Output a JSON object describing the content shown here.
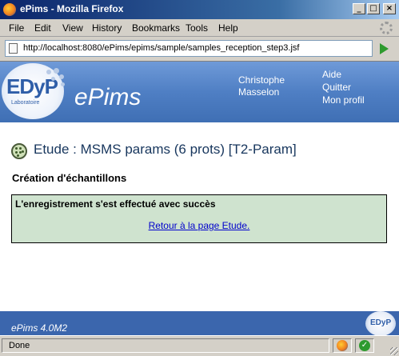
{
  "window": {
    "title": "ePims - Mozilla Firefox",
    "controls": {
      "minimize": "_",
      "maximize": "□",
      "close": "×"
    }
  },
  "menubar": {
    "items": [
      "File",
      "Edit",
      "View",
      "History",
      "Bookmarks",
      "Tools",
      "Help"
    ]
  },
  "navbar": {
    "url": "http://localhost:8080/ePims/epims/sample/samples_reception_step3.jsf"
  },
  "banner": {
    "logo_text": "EDyP",
    "logo_sub": "Laboratoire",
    "app_name": "ePims",
    "user_name": "Christophe Masselon",
    "links": [
      "Aide",
      "Quitter",
      "Mon profil"
    ]
  },
  "main": {
    "page_title": "Etude : MSMS params (6 prots) [T2-Param]",
    "section_title": "Création d'échantillons",
    "success_message": "L'enregistrement s'est effectué avec succès",
    "back_link": "Retour à la page Etude."
  },
  "footer": {
    "version": "ePims 4.0M2",
    "logo_text": "EDyP"
  },
  "statusbar": {
    "status": "Done",
    "check_glyph": "✓"
  },
  "colors": {
    "banner": "#4f7fc4",
    "footer": "#3b66ad",
    "success_bg": "#cfe3cf",
    "title_text": "#17365d",
    "link": "#0000cc"
  },
  "icons": [
    "firefox-icon",
    "page-icon",
    "go-arrow-icon",
    "throbber-icon",
    "study-icon",
    "firefox-status-icon",
    "check-icon"
  ]
}
